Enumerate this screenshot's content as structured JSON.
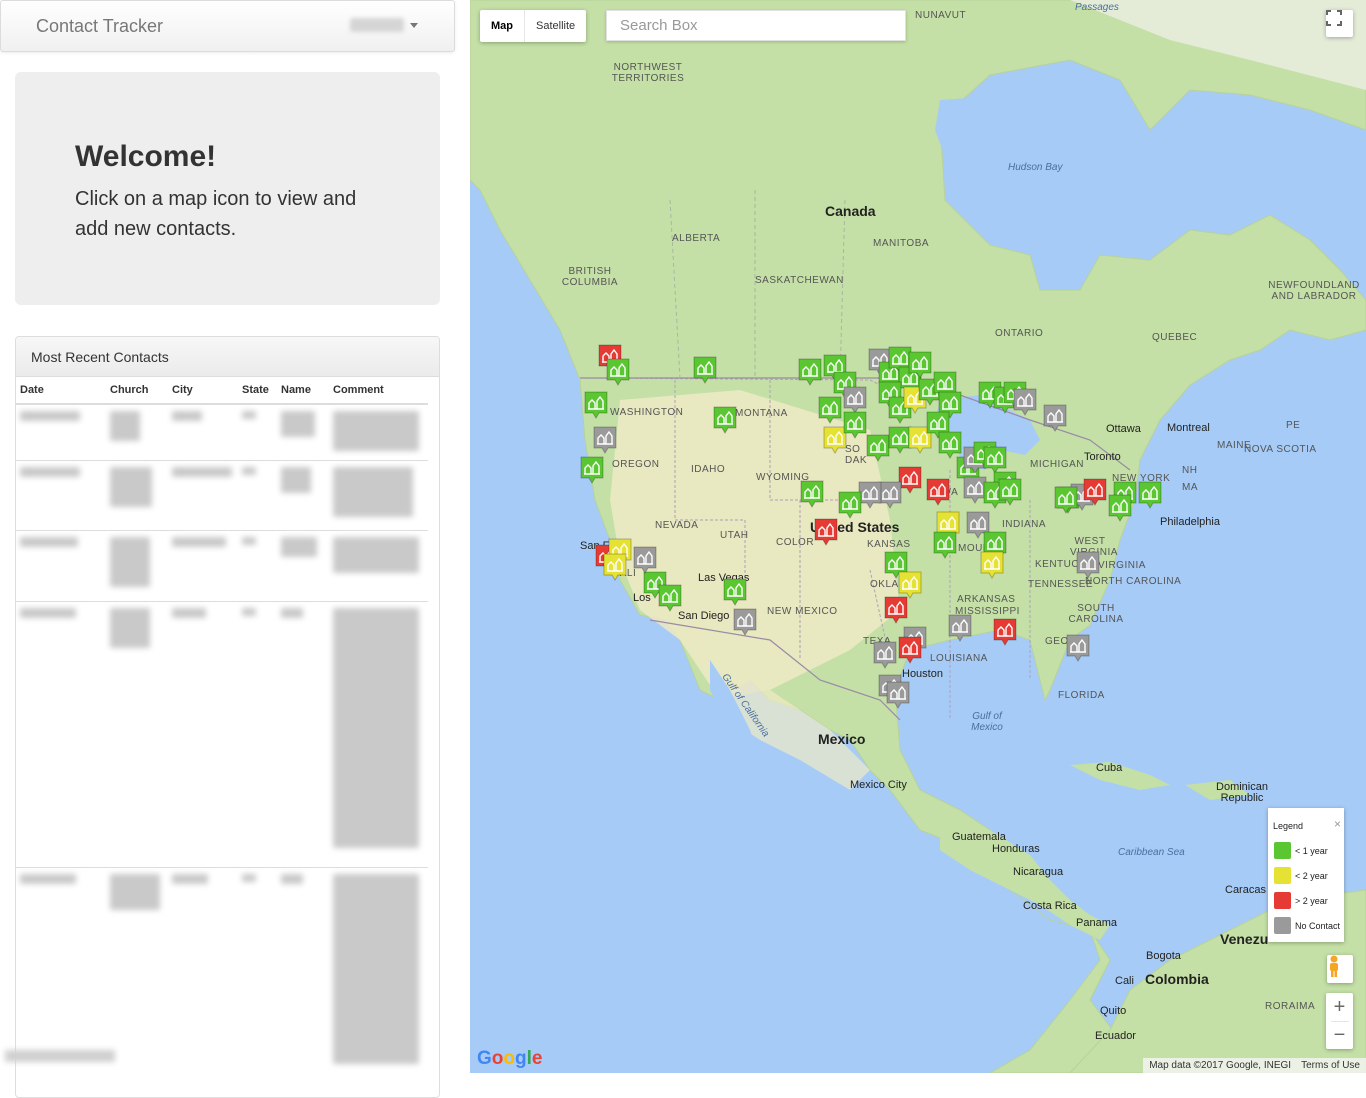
{
  "navbar": {
    "brand": "Contact Tracker"
  },
  "welcome": {
    "heading": "Welcome!",
    "text": "Click on a map icon to view and add new contacts."
  },
  "contacts_panel": {
    "heading": "Most Recent Contacts",
    "columns": [
      "Date",
      "Church",
      "City",
      "State",
      "Name",
      "Comment"
    ]
  },
  "map": {
    "type_map": "Map",
    "type_satellite": "Satellite",
    "search_placeholder": "Search Box",
    "legend": {
      "title": "Legend",
      "close": "×",
      "items": [
        {
          "label": "< 1 year",
          "color": "#5ac631"
        },
        {
          "label": "< 2 year",
          "color": "#e5e233"
        },
        {
          "label": "> 2 year",
          "color": "#e63b35"
        },
        {
          "label": "No Contact",
          "color": "#9a9a9a"
        }
      ]
    },
    "zoom_in": "+",
    "zoom_out": "−",
    "google": "Google",
    "attribution": "Map data ©2017 Google, INEGI",
    "terms": "Terms of Use",
    "labels": {
      "canada": "Canada",
      "united_states": "United States",
      "mexico": "Mexico",
      "hudson_bay": "Hudson Bay",
      "gulf_of_mexico": "Gulf of Mexico",
      "gulf_of_california": "Gulf of California",
      "caribbean_sea": "Caribbean Sea",
      "nunavut": "NUNAVUT",
      "northwest_territories": "NORTHWEST TERRITORIES",
      "alberta": "ALBERTA",
      "british_columbia": "BRITISH COLUMBIA",
      "saskatchewan": "SASKATCHEWAN",
      "manitoba": "MANITOBA",
      "ontario": "ONTARIO",
      "quebec": "QUEBEC",
      "newfoundland": "NEWFOUNDLAND AND LABRADOR",
      "washington": "WASHINGTON",
      "montana": "MONTANA",
      "oregon": "OREGON",
      "idaho": "IDAHO",
      "wyoming": "WYOMING",
      "nevada": "NEVADA",
      "utah": "UTAH",
      "colorado": "COLOR",
      "kansas": "KANSAS",
      "california": "CALI",
      "new_mexico": "NEW MEXICO",
      "oklahoma": "OKLA",
      "texas": "TEXA",
      "iowa": "IOWA",
      "missouri": "MOURI",
      "arkansas": "ARKANSAS",
      "mississippi": "MISSISSIPPI",
      "louisiana": "LOUISIANA",
      "tennessee": "TENNESSEE",
      "kentucky": "KENTUCKY",
      "indiana": "INDIANA",
      "michigan": "MICHIGAN",
      "west_virginia": "WEST VIRGINIA",
      "virginia": "VIRGINIA",
      "north_carolina": "NORTH CAROLINA",
      "south_carolina": "SOUTH CAROLINA",
      "georgia": "GEOR",
      "florida": "FLORIDA",
      "new_york": "NEW YORK",
      "maine": "MAINE",
      "south_dakota": "SO DAK",
      "pe": "PE",
      "nh": "NH",
      "ma": "MA",
      "nova_scotia": "NOVA SCOTIA",
      "passages": "Passages",
      "ottawa": "Ottawa",
      "montreal": "Montreal",
      "toronto": "Toronto",
      "philadelphia": "Philadelphia",
      "san_francisco": "San Fr",
      "las_vegas": "Las Vegas",
      "los_angeles": "Los",
      "san_diego": "San Diego",
      "houston": "Houston",
      "mexico_city": "Mexico City",
      "cuba": "Cuba",
      "dominican_republic": "Dominican Republic",
      "guatemala": "Guatemala",
      "honduras": "Honduras",
      "nicaragua": "Nicaragua",
      "costa_rica": "Costa Rica",
      "panama": "Panama",
      "caracas": "Caracas",
      "venezuela": "Venezu",
      "bogota": "Bogota",
      "colombia": "Colombia",
      "cali": "Cali",
      "quito": "Quito",
      "ecuador": "Ecuador",
      "roraima": "RORAIMA"
    }
  }
}
